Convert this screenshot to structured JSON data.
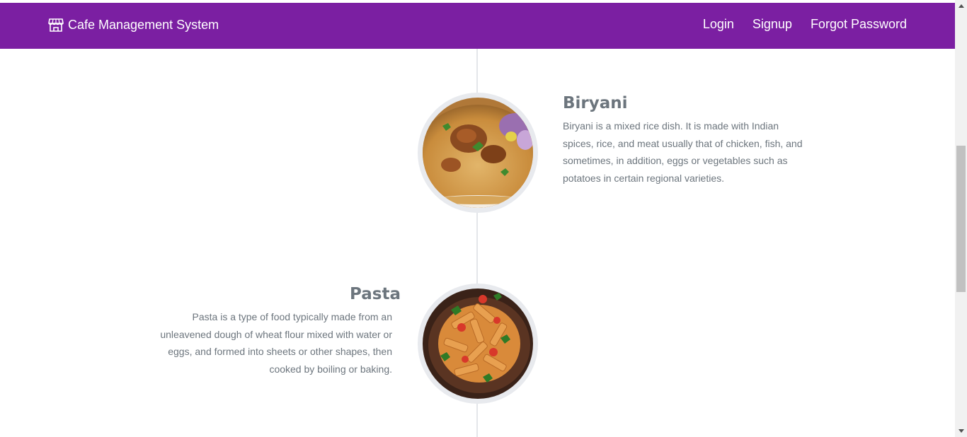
{
  "navbar": {
    "brand_icon": "shop-icon",
    "brand": "Cafe Management System",
    "links": [
      "Login",
      "Signup",
      "Forgot Password"
    ],
    "background_color": "#7b1fa2"
  },
  "items": [
    {
      "title": "Biryani",
      "image": "biryani-image",
      "description": "Biryani is a mixed rice dish. It is made with Indian spices, rice, and meat usually that of chicken, fish, and sometimes, in addition, eggs or vegetables such as potatoes in certain regional varieties."
    },
    {
      "title": "Pasta",
      "image": "pasta-image",
      "description": "Pasta is a type of food typically made from an unleavened dough of wheat flour mixed with water or eggs, and formed into sheets or other shapes, then cooked by boiling or baking."
    }
  ]
}
